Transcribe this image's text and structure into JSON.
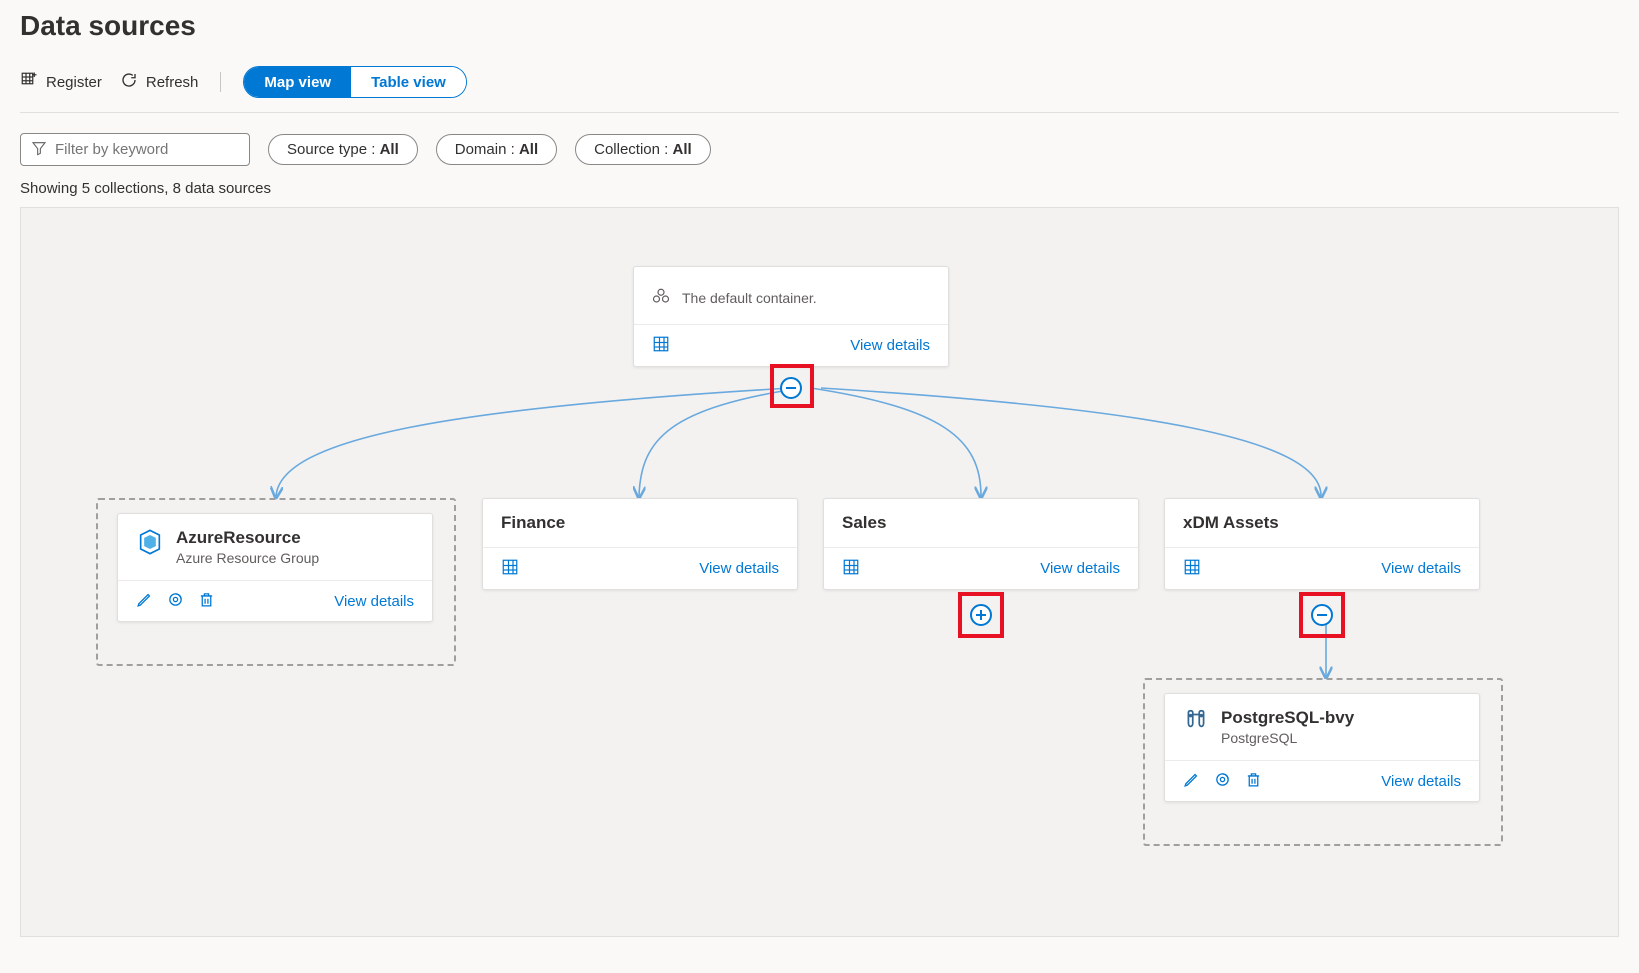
{
  "page": {
    "title": "Data sources"
  },
  "toolbar": {
    "register": "Register",
    "refresh": "Refresh",
    "view_map": "Map view",
    "view_table": "Table view"
  },
  "filters": {
    "keyword_placeholder": "Filter by keyword",
    "source_type_label": "Source type :",
    "source_type_value": "All",
    "domain_label": "Domain :",
    "domain_value": "All",
    "collection_label": "Collection :",
    "collection_value": "All"
  },
  "status": "Showing 5 collections, 8 data sources",
  "links": {
    "view_details": "View details"
  },
  "nodes": {
    "root": {
      "title": "The default container."
    },
    "azure_resource": {
      "title": "AzureResource",
      "subtitle": "Azure Resource Group"
    },
    "finance": {
      "title": "Finance"
    },
    "sales": {
      "title": "Sales"
    },
    "xdm": {
      "title": "xDM Assets"
    },
    "postgres": {
      "title": "PostgreSQL-bvy",
      "subtitle": "PostgreSQL"
    }
  }
}
